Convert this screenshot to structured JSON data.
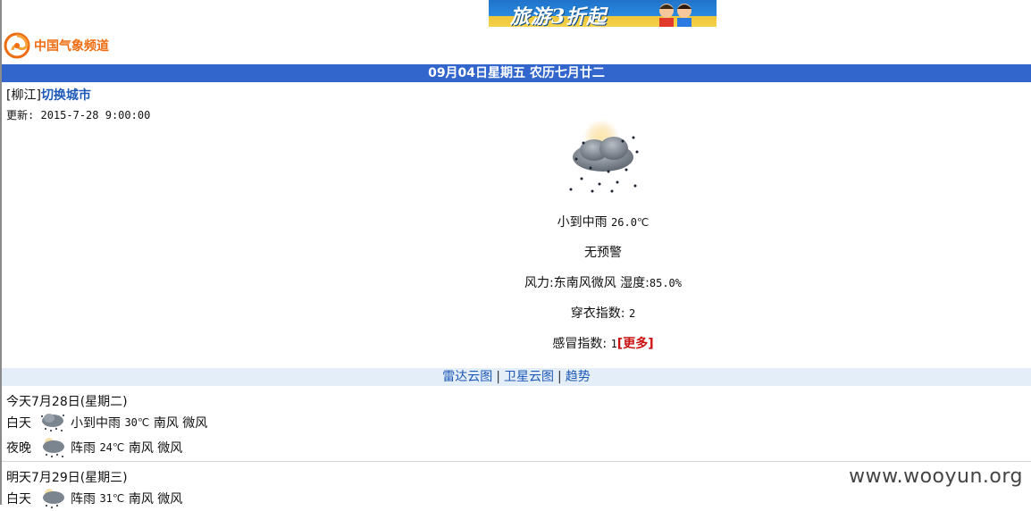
{
  "ad": {
    "text": "旅游3折起"
  },
  "logo": {
    "text": "中国气象频道",
    "accent": "#ee6d12"
  },
  "date_bar": {
    "text": "09月04日星期五  农历七月廿二",
    "bg": "#3366cc"
  },
  "city": {
    "name": "[柳江]",
    "switch_label": "切换城市"
  },
  "update": {
    "label": "更新:",
    "time": "2015-7-28 9:00:00"
  },
  "current": {
    "icon": "light-rain-icon",
    "condition": "小到中雨",
    "temp": "26.0℃",
    "warning": "无预警",
    "wind_label": "风力:",
    "wind": "东南风微风",
    "humidity_label": "湿度:",
    "humidity": "85.0%",
    "dress_label": "穿衣指数:",
    "dress": "2",
    "cold_label": "感冒指数:",
    "cold": "1",
    "more_label": "[更多]"
  },
  "links": [
    "雷达云图",
    "卫星云图",
    "趋势"
  ],
  "forecast": [
    {
      "date": "今天7月28日(星期二)",
      "periods": [
        {
          "label": "白天",
          "icon": "rain-icon",
          "weather": "小到中雨",
          "temp": "30℃",
          "wind_dir": "南风",
          "wind": "微风"
        },
        {
          "label": "夜晚",
          "icon": "shower-icon",
          "weather": "阵雨",
          "temp": "24℃",
          "wind_dir": "南风",
          "wind": "微风"
        }
      ]
    },
    {
      "date": "明天7月29日(星期三)",
      "periods": [
        {
          "label": "白天",
          "icon": "shower-icon",
          "weather": "阵雨",
          "temp": "31℃",
          "wind_dir": "南风",
          "wind": "微风"
        }
      ]
    }
  ],
  "watermark": "www.wooyun.org"
}
